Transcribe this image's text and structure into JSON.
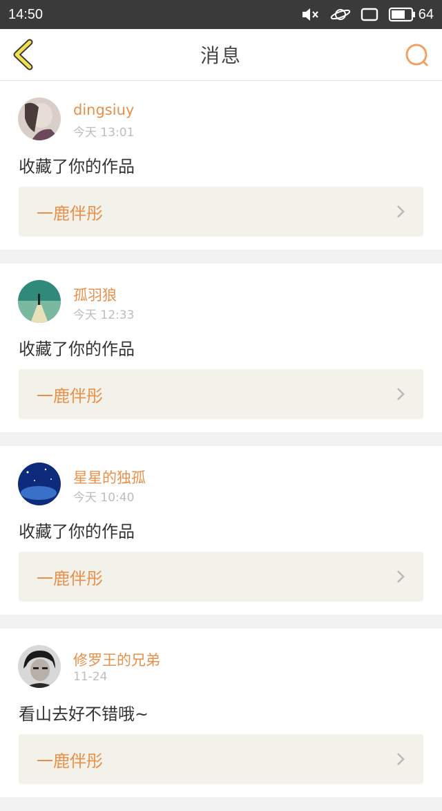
{
  "status_bar": {
    "time": "14:50",
    "battery": "64",
    "icons": [
      "mute-icon",
      "planet-icon",
      "screen-rotation-icon",
      "battery-icon"
    ]
  },
  "header": {
    "title": "消息",
    "back_icon": "chevron-left-icon",
    "search_icon": "search-icon"
  },
  "colors": {
    "accent": "#e8904a",
    "back_arrow": "#e8d83a",
    "link_bg": "#f3f2ea",
    "status_bar_bg": "#3a3a3a"
  },
  "messages": [
    {
      "user": "dingsiuy",
      "time": "今天 13:01",
      "text": "收藏了你的作品",
      "work": "一鹿伴彤"
    },
    {
      "user": "孤羽狼",
      "time": "今天 12:33",
      "text": "收藏了你的作品",
      "work": "一鹿伴彤"
    },
    {
      "user": "星星的独孤",
      "time": "今天 10:40",
      "text": "收藏了你的作品",
      "work": "一鹿伴彤"
    },
    {
      "user": "修罗王的兄弟",
      "time": "11-24",
      "text": "看山去好不错哦~",
      "work": "一鹿伴彤"
    }
  ]
}
